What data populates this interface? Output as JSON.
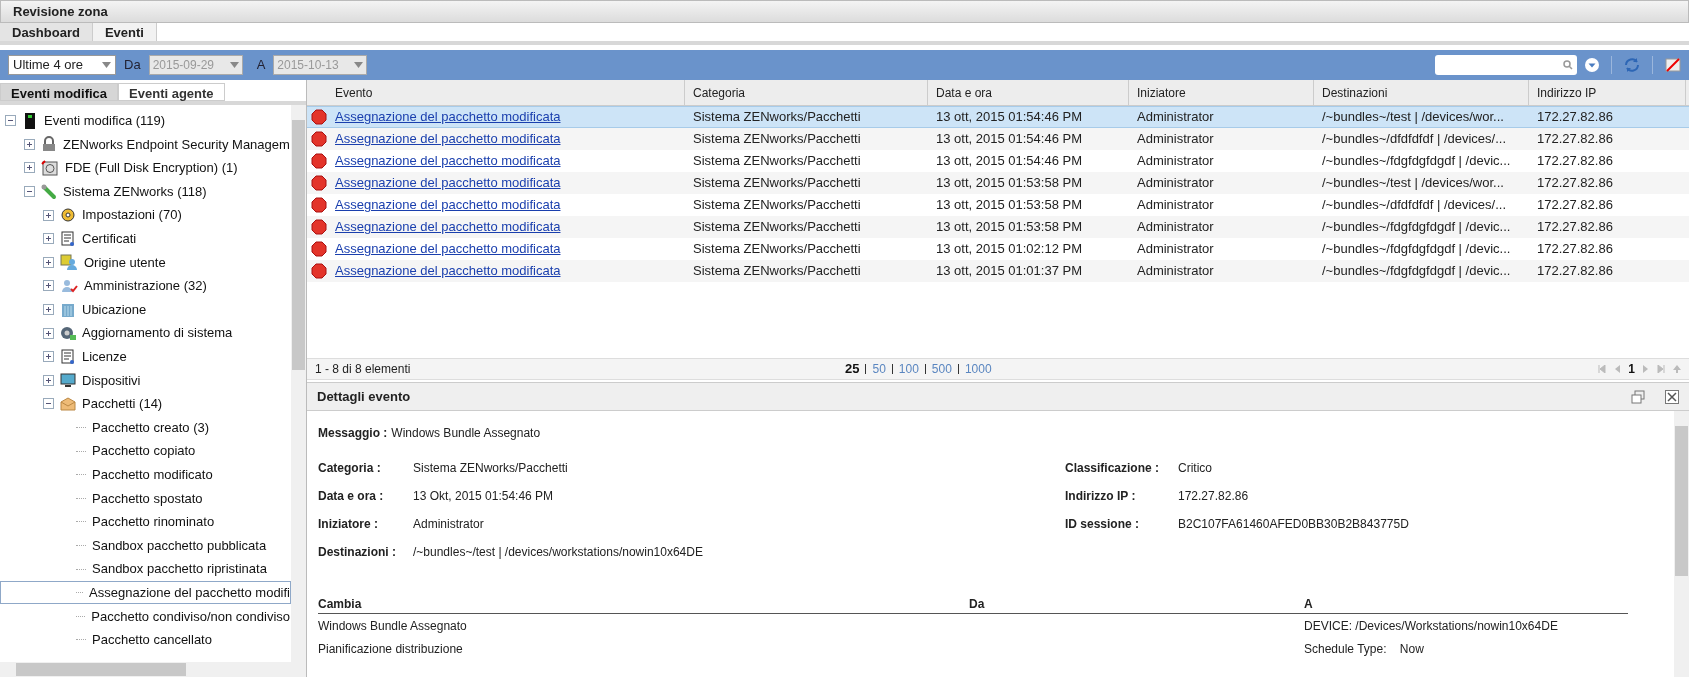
{
  "window": {
    "title": "Revisione zona"
  },
  "tabs": [
    {
      "label": "Dashboard",
      "selected": false
    },
    {
      "label": "Eventi",
      "selected": true
    }
  ],
  "toolbar": {
    "range": "Ultime 4 ore",
    "from_label": "Da",
    "from": "2015-09-29",
    "to_label": "A",
    "to": "2015-10-13"
  },
  "left_tabs": [
    {
      "label": "Eventi modifica",
      "selected": true
    },
    {
      "label": "Eventi agente",
      "selected": false
    }
  ],
  "tree": [
    {
      "label": "Eventi modifica (119)",
      "expanded": true,
      "children": [
        {
          "label": "ZENworks Endpoint Security Managem",
          "expanded": false
        },
        {
          "label": "FDE (Full Disk Encryption) (1)",
          "expanded": false
        },
        {
          "label": "Sistema ZENworks (118)",
          "expanded": true,
          "children": [
            {
              "label": "Impostazioni (70)",
              "expanded": false
            },
            {
              "label": "Certificati",
              "expanded": false
            },
            {
              "label": "Origine utente",
              "expanded": false
            },
            {
              "label": "Amministrazione (32)",
              "expanded": false
            },
            {
              "label": "Ubicazione",
              "expanded": false
            },
            {
              "label": "Aggiornamento di sistema",
              "expanded": false
            },
            {
              "label": "Licenze",
              "expanded": false
            },
            {
              "label": "Dispositivi",
              "expanded": false
            },
            {
              "label": "Pacchetti (14)",
              "expanded": true,
              "children": [
                {
                  "label": "Pacchetto creato (3)",
                  "selected": false
                },
                {
                  "label": "Pacchetto copiato",
                  "selected": false
                },
                {
                  "label": "Pacchetto modificato",
                  "selected": false
                },
                {
                  "label": "Pacchetto spostato",
                  "selected": false
                },
                {
                  "label": "Pacchetto rinominato",
                  "selected": false
                },
                {
                  "label": "Sandbox pacchetto pubblicata",
                  "selected": false
                },
                {
                  "label": "Sandbox pacchetto ripristinata",
                  "selected": false
                },
                {
                  "label": "Assegnazione del pacchetto modifi",
                  "selected": true
                },
                {
                  "label": "Pacchetto condiviso/non condiviso",
                  "selected": false
                },
                {
                  "label": "Pacchetto cancellato",
                  "selected": false
                }
              ]
            }
          ]
        }
      ]
    }
  ],
  "table": {
    "columns": [
      "Evento",
      "Categoria",
      "Data e ora",
      "Iniziatore",
      "Destinazioni",
      "Indirizzo IP"
    ],
    "rows": [
      {
        "selected": true,
        "cells": [
          "Assegnazione del pacchetto modificata",
          "Sistema ZENworks/Pacchetti",
          "13 ott, 2015 01:54:46 PM",
          "Administrator",
          "/~bundles~/test | /devices/wor...",
          "172.27.82.86"
        ]
      },
      {
        "selected": false,
        "cells": [
          "Assegnazione del pacchetto modificata",
          "Sistema ZENworks/Pacchetti",
          "13 ott, 2015 01:54:46 PM",
          "Administrator",
          "/~bundles~/dfdfdfdf | /devices/...",
          "172.27.82.86"
        ]
      },
      {
        "selected": false,
        "cells": [
          "Assegnazione del pacchetto modificata",
          "Sistema ZENworks/Pacchetti",
          "13 ott, 2015 01:54:46 PM",
          "Administrator",
          "/~bundles~/fdgfdgfdgdf | /devic...",
          "172.27.82.86"
        ]
      },
      {
        "selected": false,
        "cells": [
          "Assegnazione del pacchetto modificata",
          "Sistema ZENworks/Pacchetti",
          "13 ott, 2015 01:53:58 PM",
          "Administrator",
          "/~bundles~/test | /devices/wor...",
          "172.27.82.86"
        ]
      },
      {
        "selected": false,
        "cells": [
          "Assegnazione del pacchetto modificata",
          "Sistema ZENworks/Pacchetti",
          "13 ott, 2015 01:53:58 PM",
          "Administrator",
          "/~bundles~/dfdfdfdf | /devices/...",
          "172.27.82.86"
        ]
      },
      {
        "selected": false,
        "cells": [
          "Assegnazione del pacchetto modificata",
          "Sistema ZENworks/Pacchetti",
          "13 ott, 2015 01:53:58 PM",
          "Administrator",
          "/~bundles~/fdgfdgfdgdf | /devic...",
          "172.27.82.86"
        ]
      },
      {
        "selected": false,
        "cells": [
          "Assegnazione del pacchetto modificata",
          "Sistema ZENworks/Pacchetti",
          "13 ott, 2015 01:02:12 PM",
          "Administrator",
          "/~bundles~/fdgfdgfdgdf | /devic...",
          "172.27.82.86"
        ]
      },
      {
        "selected": false,
        "cells": [
          "Assegnazione del pacchetto modificata",
          "Sistema ZENworks/Pacchetti",
          "13 ott, 2015 01:01:37 PM",
          "Administrator",
          "/~bundles~/fdgfdgfdgdf | /devic...",
          "172.27.82.86"
        ]
      }
    ]
  },
  "pager": {
    "summary": "1 - 8 di 8 elementi",
    "sizes": [
      {
        "label": "25",
        "selected": true
      },
      {
        "label": "50",
        "selected": false
      },
      {
        "label": "100",
        "selected": false
      },
      {
        "label": "500",
        "selected": false
      },
      {
        "label": "1000",
        "selected": false
      }
    ],
    "page": "1"
  },
  "details": {
    "title": "Dettagli evento",
    "message_label": "Messaggio :",
    "message": "Windows Bundle Assegnato",
    "left": [
      {
        "label": "Categoria :",
        "value": "Sistema ZENworks/Pacchetti"
      },
      {
        "label": "Data e ora :",
        "value": "13 Okt, 2015 01:54:46 PM"
      },
      {
        "label": "Iniziatore :",
        "value": "Administrator"
      },
      {
        "label": "Destinazioni :",
        "value": "/~bundles~/test | /devices/workstations/nowin10x64DE"
      }
    ],
    "right": [
      {
        "label": "Classificazione :",
        "value": "Critico"
      },
      {
        "label": "Indirizzo IP :",
        "value": "172.27.82.86"
      },
      {
        "label": "ID sessione :",
        "value": "B2C107FA61460AFED0BB30B2B843775D"
      }
    ],
    "changes": {
      "columns": [
        "Cambia",
        "Da",
        "A"
      ],
      "rows": [
        [
          "Windows Bundle Assegnato",
          "",
          "DEVICE: /Devices/Workstations/nowin10x64DE"
        ],
        [
          "Pianificazione distribuzione",
          "",
          "Schedule Type:    Now"
        ]
      ]
    }
  }
}
